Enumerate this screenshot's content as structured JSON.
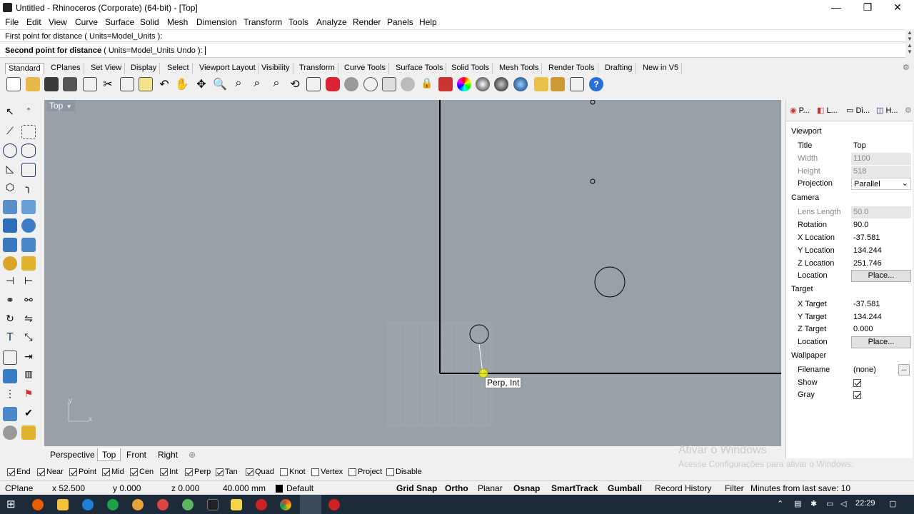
{
  "window": {
    "title": "Untitled - Rhinoceros (Corporate) (64-bit) - [Top]",
    "minimize": "—",
    "maximize": "❐",
    "close": "✕"
  },
  "menu": [
    "File",
    "Edit",
    "View",
    "Curve",
    "Surface",
    "Solid",
    "Mesh",
    "Dimension",
    "Transform",
    "Tools",
    "Analyze",
    "Render",
    "Panels",
    "Help"
  ],
  "command": {
    "history": "First point for distance ( Units=Model_Units ):",
    "prompt_bold": "Second point for distance",
    "prompt_rest": " ( Units=Model_Units  Undo ): "
  },
  "toolbar_tabs": [
    "Standard",
    "CPlanes",
    "Set View",
    "Display",
    "Select",
    "Viewport Layout",
    "Visibility",
    "Transform",
    "Curve Tools",
    "Surface Tools",
    "Solid Tools",
    "Mesh Tools",
    "Render Tools",
    "Drafting",
    "New in V5"
  ],
  "viewport": {
    "name": "Top",
    "tooltip": "Perp, Int",
    "axis_x": "x",
    "axis_y": "y"
  },
  "viewport_tabs": [
    "Perspective",
    "Top",
    "Front",
    "Right"
  ],
  "panel": {
    "tabs": [
      "P...",
      "L...",
      "Di...",
      "H..."
    ],
    "viewport_section": "Viewport",
    "title_label": "Title",
    "title_value": "Top",
    "width_label": "Width",
    "width_value": "1100",
    "height_label": "Height",
    "height_value": "518",
    "projection_label": "Projection",
    "projection_value": "Parallel",
    "camera_section": "Camera",
    "lens_label": "Lens Length",
    "lens_value": "50.0",
    "rotation_label": "Rotation",
    "rotation_value": "90.0",
    "xloc_label": "X Location",
    "xloc_value": "-37.581",
    "yloc_label": "Y Location",
    "yloc_value": "134.244",
    "zloc_label": "Z Location",
    "zloc_value": "251.746",
    "location_label": "Location",
    "place_button": "Place...",
    "target_section": "Target",
    "xtgt_label": "X Target",
    "xtgt_value": "-37.581",
    "ytgt_label": "Y Target",
    "ytgt_value": "134.244",
    "ztgt_label": "Z Target",
    "ztgt_value": "0.000",
    "tlocation_label": "Location",
    "tplace_button": "Place...",
    "wallpaper_section": "Wallpaper",
    "filename_label": "Filename",
    "filename_value": "(none)",
    "browse": "...",
    "show_label": "Show",
    "show_checked": true,
    "gray_label": "Gray",
    "gray_checked": true
  },
  "osnaps": [
    {
      "label": "End",
      "checked": true
    },
    {
      "label": "Near",
      "checked": true
    },
    {
      "label": "Point",
      "checked": true
    },
    {
      "label": "Mid",
      "checked": true
    },
    {
      "label": "Cen",
      "checked": true
    },
    {
      "label": "Int",
      "checked": true
    },
    {
      "label": "Perp",
      "checked": true
    },
    {
      "label": "Tan",
      "checked": true
    },
    {
      "label": "Quad",
      "checked": true
    },
    {
      "label": "Knot",
      "checked": false
    },
    {
      "label": "Vertex",
      "checked": false
    },
    {
      "label": "Project",
      "checked": false
    },
    {
      "label": "Disable",
      "checked": false
    }
  ],
  "status": {
    "cplane": "CPlane",
    "x": "x 52.500",
    "y": "y 0.000",
    "z": "z 0.000",
    "units": "40.000 mm",
    "layer": "Default",
    "grid_snap": "Grid Snap",
    "ortho": "Ortho",
    "planar": "Planar",
    "osnap": "Osnap",
    "smarttrack": "SmartTrack",
    "gumball": "Gumball",
    "record_history": "Record History",
    "filter": "Filter",
    "autosave": "Minutes from last save: 10"
  },
  "watermark": {
    "line1": "Ativar o Windows",
    "line2": "Acesse Configurações para ativar o Windows."
  },
  "taskbar": {
    "time": "22:29"
  },
  "colors": {
    "viewport_bg": "#98a0a8",
    "taskbar_bg": "#1c2a3a"
  }
}
